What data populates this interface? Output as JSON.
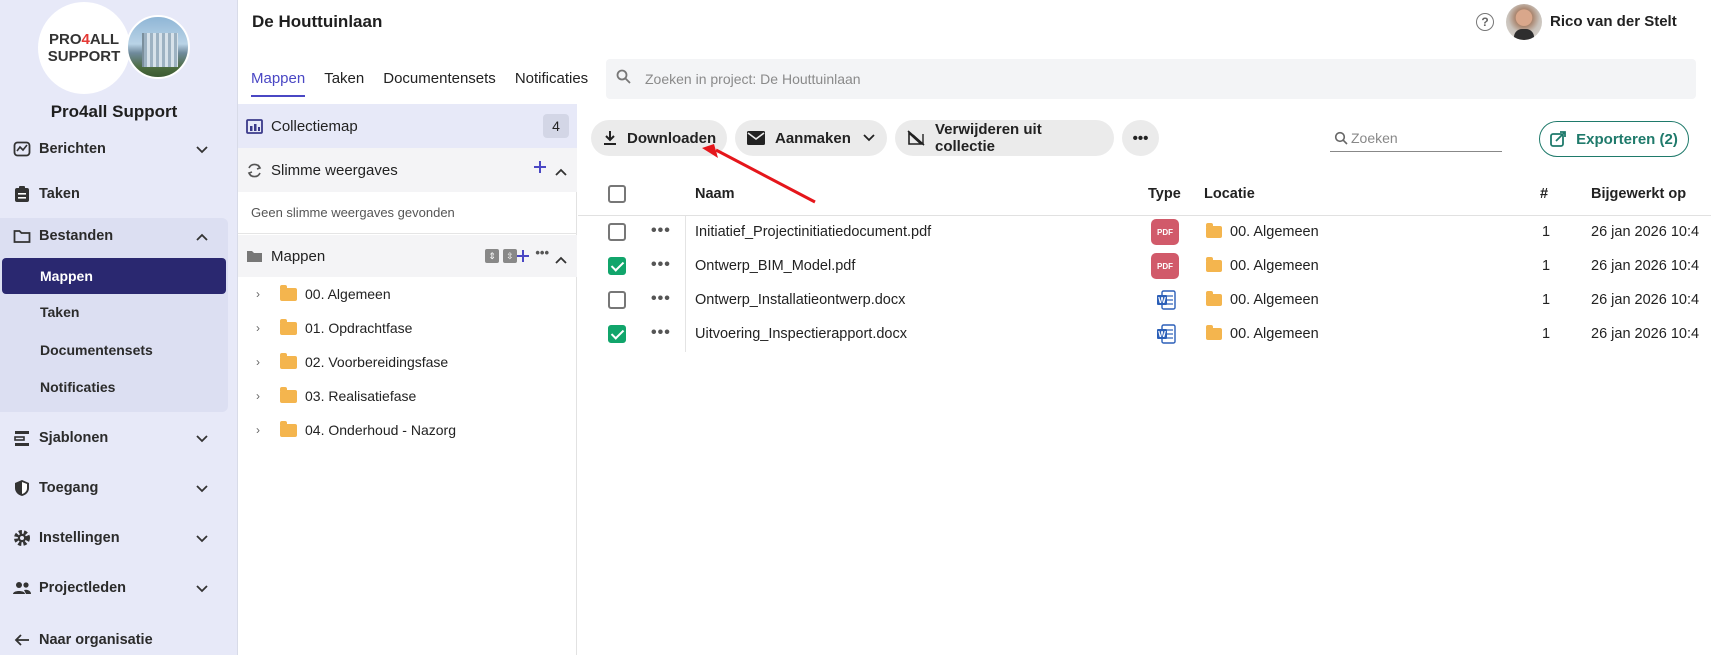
{
  "sidebar": {
    "logo_text_1": "PRO",
    "logo_text_4": "4",
    "logo_text_2": "ALL",
    "logo_text_3": "SUPPORT",
    "org_name": "Pro4all Support",
    "items": {
      "berichten": "Berichten",
      "taken": "Taken",
      "bestanden": "Bestanden",
      "sjablonen": "Sjablonen",
      "toegang": "Toegang",
      "instellingen": "Instellingen",
      "projectleden": "Projectleden",
      "naar_organisatie": "Naar organisatie"
    },
    "sub_items": {
      "mappen": "Mappen",
      "taken": "Taken",
      "documentensets": "Documentensets",
      "notificaties": "Notificaties"
    }
  },
  "header": {
    "project_title": "De Houttuinlaan",
    "help": "?",
    "user_name": "Rico van der Stelt"
  },
  "tabs": [
    "Mappen",
    "Taken",
    "Documentensets",
    "Notificaties"
  ],
  "search": {
    "placeholder": "Zoeken in project: De Houttuinlaan"
  },
  "panel": {
    "collectiemap": "Collectiemap",
    "collectiemap_count": "4",
    "slimme_weergaves": "Slimme weergaves",
    "geen_slimme": "Geen slimme weergaves gevonden",
    "mappen": "Mappen",
    "folders": [
      "00. Algemeen",
      "01. Opdrachtfase",
      "02. Voorbereidingsfase",
      "03. Realisatiefase",
      "04. Onderhoud - Nazorg"
    ]
  },
  "toolbar": {
    "download": "Downloaden",
    "create": "Aanmaken",
    "remove": "Verwijderen uit collectie",
    "more": "•••",
    "filter_placeholder": "Zoeken",
    "export": "Exporteren (2)"
  },
  "table": {
    "headers": {
      "name": "Naam",
      "type": "Type",
      "location": "Locatie",
      "count": "#",
      "updated": "Bijgewerkt op"
    },
    "rows": [
      {
        "name": "Initiatief_Projectinitiatiedocument.pdf",
        "type": "pdf",
        "type_label": "PDF",
        "location": "00. Algemeen",
        "count": "1",
        "updated": "26 jan 2026 10:4",
        "checked": false
      },
      {
        "name": "Ontwerp_BIM_Model.pdf",
        "type": "pdf",
        "type_label": "PDF",
        "location": "00. Algemeen",
        "count": "1",
        "updated": "26 jan 2026 10:4",
        "checked": true
      },
      {
        "name": "Ontwerp_Installatieontwerp.docx",
        "type": "word",
        "type_label": "",
        "location": "00. Algemeen",
        "count": "1",
        "updated": "26 jan 2026 10:4",
        "checked": false
      },
      {
        "name": "Uitvoering_Inspectierapport.docx",
        "type": "word",
        "type_label": "",
        "location": "00. Algemeen",
        "count": "1",
        "updated": "26 jan 2026 10:4",
        "checked": true
      }
    ]
  },
  "colors": {
    "accent": "#4a47c4",
    "active_nav": "#2a2870",
    "export": "#1f7a6b",
    "check": "#11a56b",
    "pdf": "#d15a6a",
    "folder": "#f4b54e",
    "annotation_arrow": "#e5161b"
  },
  "icons": [
    "dashboard-icon",
    "tasks-icon",
    "folder-icon",
    "templates-icon",
    "shield-icon",
    "gear-icon",
    "people-icon",
    "arrow-left-icon",
    "download-icon",
    "mail-icon",
    "remove-icon",
    "export-icon",
    "search-icon"
  ]
}
